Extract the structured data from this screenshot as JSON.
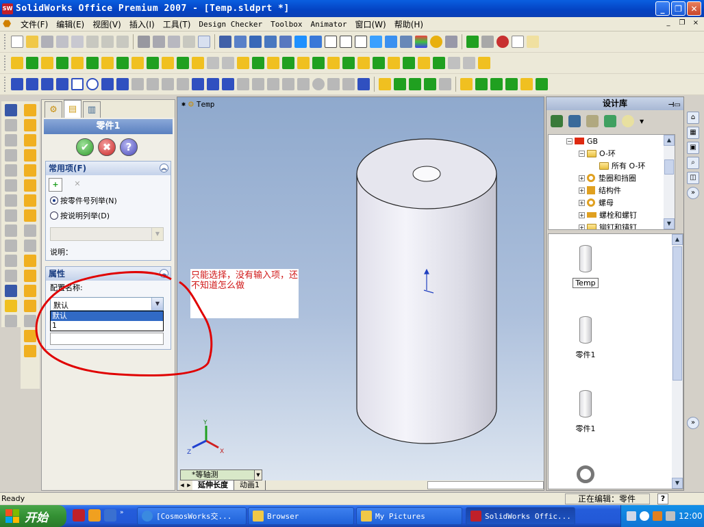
{
  "window": {
    "title": "SolidWorks Office Premium 2007 - [Temp.sldprt *]",
    "app_icon": "SW",
    "buttons": [
      "_",
      "❐",
      "✕"
    ]
  },
  "menubar": {
    "items": [
      "文件(F)",
      "编辑(E)",
      "视图(V)",
      "插入(I)",
      "工具(T)",
      "Design Checker",
      "Toolbox",
      "Animator",
      "窗口(W)",
      "帮助(H)"
    ],
    "doc_buttons": [
      "_",
      "❐",
      "×"
    ]
  },
  "property_manager": {
    "title": "零件1",
    "ok": "✔",
    "cancel": "✖",
    "help": "?",
    "common_group": {
      "title": "常用项(F)",
      "radio_by_part": "按零件号列举(N)",
      "radio_by_desc": "按说明列举(D)",
      "desc_label": "说明："
    },
    "props_group": {
      "title": "属性",
      "config_label": "配置名称:",
      "config_value": "默认",
      "options": [
        "默认",
        "1"
      ]
    }
  },
  "viewport": {
    "tree_label": "Temp",
    "view_name": "*等轴测",
    "tabs": [
      "延伸长度",
      "动画1"
    ],
    "axes": {
      "x": "X",
      "y": "Y",
      "z": "Z"
    }
  },
  "annotation": {
    "text": "只能选择，没有输入项，还不知道怎么做"
  },
  "design_library": {
    "title": "设计库",
    "tree": [
      {
        "label": "GB",
        "level": 0,
        "expander": "−"
      },
      {
        "label": "O-环",
        "level": 1,
        "expander": "−"
      },
      {
        "label": "所有 O-环",
        "level": 2,
        "expander": ""
      },
      {
        "label": "垫圈和挡圈",
        "level": 1,
        "expander": "+"
      },
      {
        "label": "结构件",
        "level": 1,
        "expander": "+"
      },
      {
        "label": "螺母",
        "level": 1,
        "expander": "+"
      },
      {
        "label": "螺栓和螺钉",
        "level": 1,
        "expander": "+"
      },
      {
        "label": "铆钉和锚钉",
        "level": 1,
        "expander": "+"
      }
    ],
    "thumbnails": [
      {
        "label": "Temp"
      },
      {
        "label": "零件1"
      },
      {
        "label": "零件1"
      }
    ]
  },
  "status": {
    "left": "Ready",
    "editing": "正在编辑：零件",
    "help": "?"
  },
  "taskbar": {
    "start": "开始",
    "tasks": [
      {
        "label": "[CosmosWorks交..."
      },
      {
        "label": "Browser"
      },
      {
        "label": "My Pictures"
      },
      {
        "label": "SolidWorks Offic..."
      }
    ],
    "clock": "12:00"
  }
}
